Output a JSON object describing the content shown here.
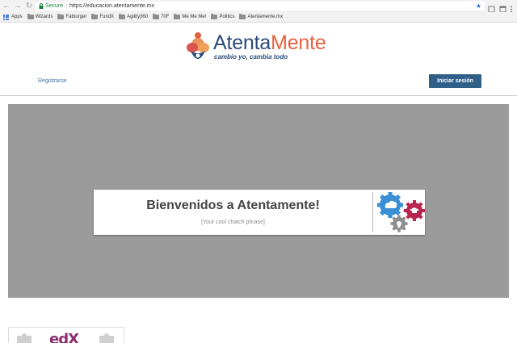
{
  "browser": {
    "secure_label": "Secure",
    "url": "https://educacion.atentamente.mx",
    "bookmarks": [
      "Apps",
      "Wizards",
      "Fatburger",
      "FundX",
      "Agility360",
      "70F",
      "Me Me Me!",
      "Politics",
      "Atentamente.mx"
    ]
  },
  "site": {
    "logo_part1": "Atenta",
    "logo_part2": "Mente",
    "tagline": "cambio yo, cambia todo",
    "register_label": "Registrarse",
    "login_label": "Iniciar sesión"
  },
  "hero": {
    "welcome": "Bienvenidos a Atentamente!",
    "phrase": "[Your cool chatch phrase]"
  },
  "footer": {
    "edx_logo": "edX"
  },
  "colors": {
    "brand_blue": "#2a4a7a",
    "brand_orange": "#e4633f",
    "button": "#2f5f89",
    "hero_bg": "#9b9b9b",
    "edx": "#8b2c6f"
  }
}
